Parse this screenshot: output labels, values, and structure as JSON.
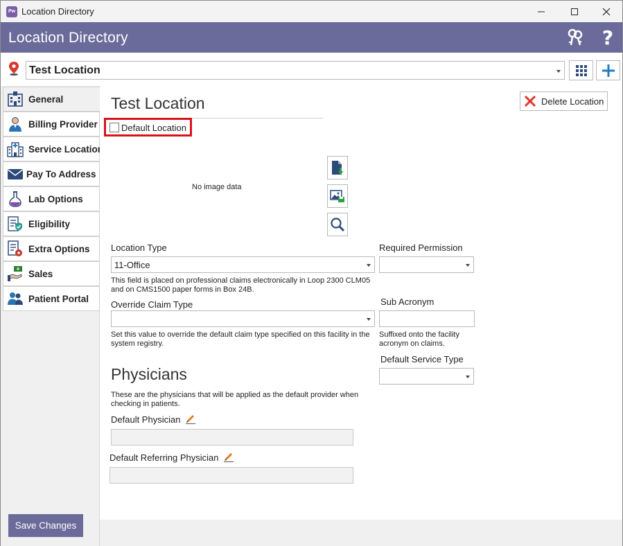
{
  "window": {
    "title": "Location Directory",
    "app_icon_text": "Pw"
  },
  "header": {
    "title": "Location Directory",
    "icons": [
      "keys-icon",
      "help-icon"
    ]
  },
  "location_bar": {
    "selected_location": "Test Location"
  },
  "sidebar": {
    "items": [
      {
        "label": "General",
        "icon": "hospital-icon",
        "active": true
      },
      {
        "label": "Billing Provider",
        "icon": "doctor-icon",
        "active": false
      },
      {
        "label": "Service Location",
        "icon": "hospital-building-icon",
        "active": false
      },
      {
        "label": "Pay To Address",
        "icon": "envelope-icon",
        "active": false
      },
      {
        "label": "Lab Options",
        "icon": "flask-icon",
        "active": false
      },
      {
        "label": "Eligibility",
        "icon": "checklist-shield-icon",
        "active": false
      },
      {
        "label": "Extra Options",
        "icon": "document-gear-icon",
        "active": false
      },
      {
        "label": "Sales",
        "icon": "money-hand-icon",
        "active": false
      },
      {
        "label": "Patient Portal",
        "icon": "users-icon",
        "active": false
      }
    ],
    "save_label": "Save Changes"
  },
  "main": {
    "title": "Test Location",
    "delete_label": "Delete Location",
    "default_location_label": "Default Location",
    "default_location_checked": false,
    "image_placeholder": "No image data",
    "location_type": {
      "label": "Location Type",
      "value": "11-Office",
      "help": "This field is placed on professional claims electronically in Loop 2300 CLM05 and on CMS1500 paper forms in Box 24B."
    },
    "required_permission": {
      "label": "Required Permission",
      "value": ""
    },
    "override_claim_type": {
      "label": "Override Claim Type",
      "value": "",
      "help": "Set this value to override the default claim type specified on this facility in the system registry."
    },
    "sub_acronym": {
      "label": "Sub Acronym",
      "value": "",
      "help": "Suffixed onto the facility acronym on claims."
    },
    "default_service_type": {
      "label": "Default Service Type",
      "value": ""
    },
    "physicians": {
      "heading": "Physicians",
      "help": "These are the physicians that will be applied as the default provider when checking in patients.",
      "default_physician_label": "Default Physician",
      "default_physician_value": "",
      "default_referring_label": "Default Referring Physician",
      "default_referring_value": ""
    }
  },
  "colors": {
    "header_bg": "#6a6b9a",
    "highlight_border": "#d9121a",
    "add_icon": "#1f7bc4"
  }
}
